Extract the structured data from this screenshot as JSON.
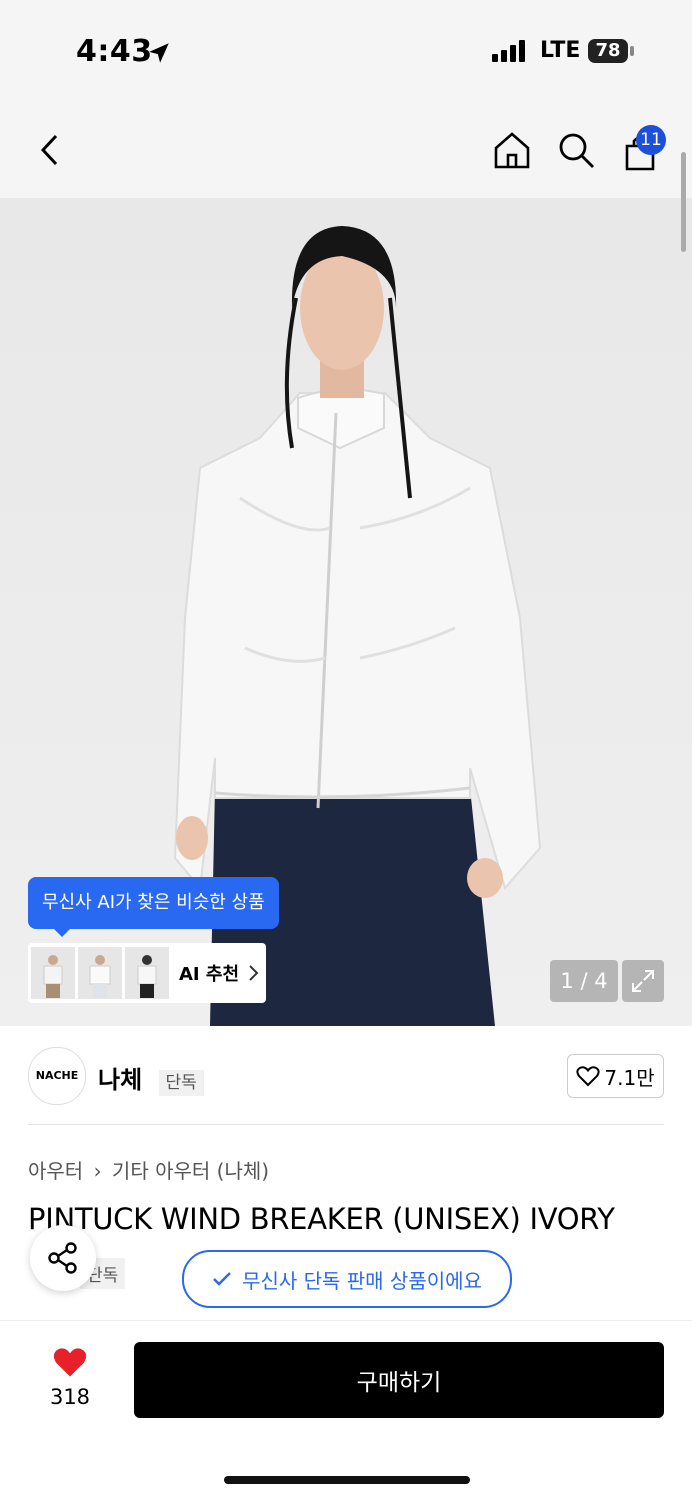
{
  "status_bar": {
    "time": "4:43",
    "network": "LTE",
    "battery": "78"
  },
  "nav": {
    "cart_count": "11"
  },
  "hero": {
    "ai_tooltip": "무신사 AI가 찾은 비슷한 상품",
    "ai_recommend_label": "AI 추천",
    "image_counter": "1 / 4"
  },
  "brand": {
    "logo_text": "NACHE",
    "name": "나체",
    "tag": "단독",
    "likes": "7.1만"
  },
  "product": {
    "breadcrumb_1": "아우터",
    "breadcrumb_2": "기타 아우터 (나체)",
    "title": "PINTUCK WIND BREAKER (UNISEX) IVORY",
    "tag": "단독",
    "exclusive_notice": "무신사 단독 판매 상품이에요"
  },
  "bottom": {
    "heart_count": "318",
    "buy_label": "구매하기"
  },
  "colors": {
    "accent_blue": "#2968f0",
    "heart_red": "#e8202a",
    "badge_blue": "#1e4fd8"
  }
}
